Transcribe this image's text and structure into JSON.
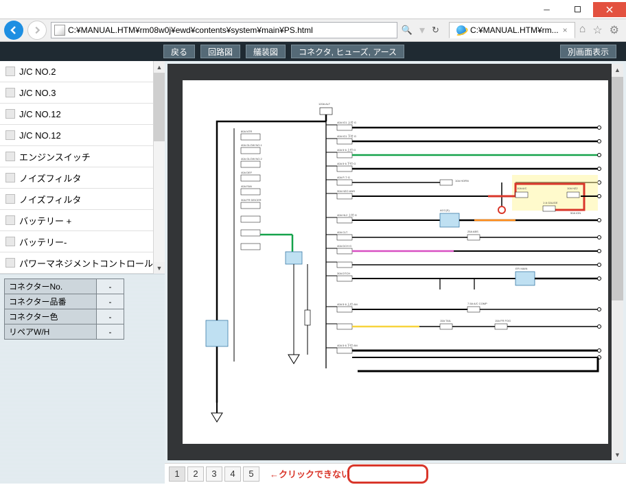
{
  "window": {
    "url": "C:¥MANUAL.HTM¥rm08w0j¥ewd¥contents¥system¥main¥PS.html",
    "tab_title": "C:¥MANUAL.HTM¥rm..."
  },
  "toolbar": {
    "back": "戻る",
    "circuit": "回路図",
    "mount": "艤装図",
    "connectors": "コネクタ, ヒューズ, アース",
    "other_screen": "別画面表示"
  },
  "sidebar": {
    "items": [
      {
        "label": "J/C NO.2"
      },
      {
        "label": "J/C NO.3"
      },
      {
        "label": "J/C NO.12"
      },
      {
        "label": "J/C NO.12"
      },
      {
        "label": "エンジンスイッチ"
      },
      {
        "label": "ノイズフィルタ"
      },
      {
        "label": "ノイズフィルタ"
      },
      {
        "label": "バッテリー +"
      },
      {
        "label": "バッテリー-"
      },
      {
        "label": "パワーマネジメントコントロール"
      }
    ]
  },
  "info_table": {
    "rows": [
      {
        "label": "コネクターNo.",
        "value": "-"
      },
      {
        "label": "コネクター品番",
        "value": "-"
      },
      {
        "label": "コネクター色",
        "value": "-"
      },
      {
        "label": "リペアW/H",
        "value": "-"
      }
    ]
  },
  "pager": {
    "pages": [
      "1",
      "2",
      "3",
      "4",
      "5"
    ],
    "note": "←クリックできない"
  },
  "diagram": {
    "top_fuse": "120A ALT",
    "left_blocks": [
      "80A NTR",
      "40A GLOW NO.1",
      "40A GLOW NO.2",
      "40A DEF",
      "40A FAN",
      "30A FR DEICER",
      "",
      "",
      ""
    ],
    "right_labels_a": [
      "40A IG1 上付·G",
      "40A IG1 下付·G",
      "40A 5·6 上付·G",
      "40A 5·6 下付·G",
      "40A P-T·G",
      "30A HZO·ANS",
      "40A HL2 上付·G",
      "40A CLT",
      "40A DCH·G",
      "30A DTCH"
    ],
    "right_labels_b": [
      "40A 5·6 上付·AN",
      "40A 5·6 下付·AN"
    ],
    "mid_right": [
      "10A HORN",
      "10A A/C",
      "10A HZ2",
      "ACC(S)",
      "25A ABS",
      "EFI MAIN",
      "7.5A A/C COMP",
      "15A TAIL",
      "15A FR FOG",
      "1·A GAUGE",
      "50A IGN"
    ]
  }
}
